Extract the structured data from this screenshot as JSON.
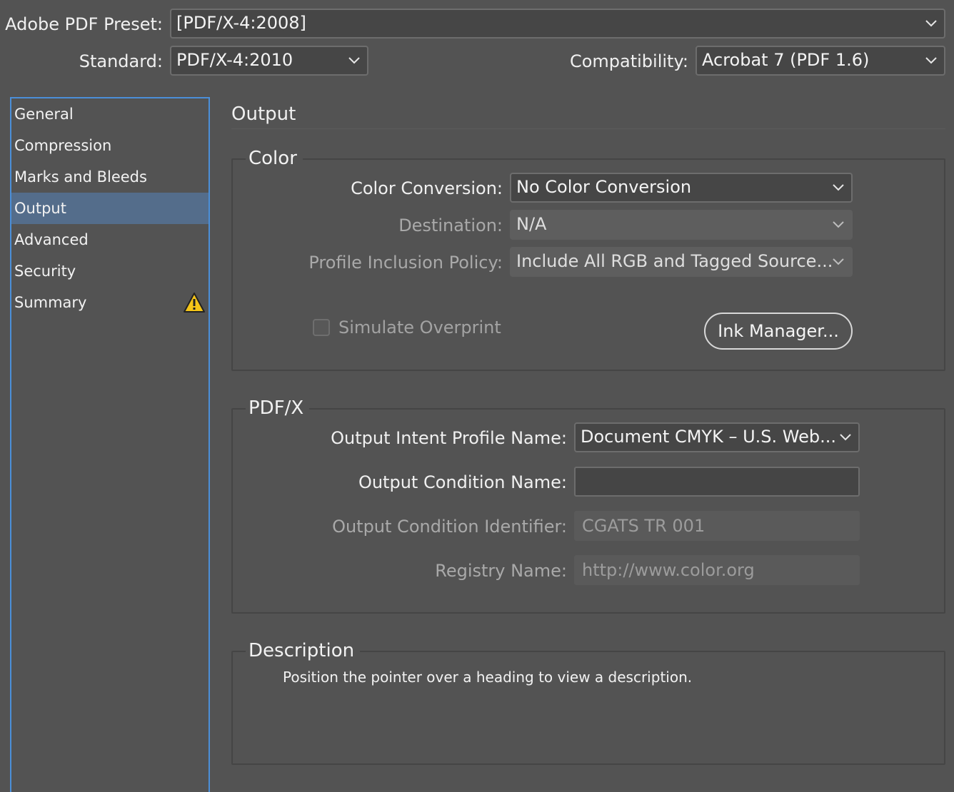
{
  "header": {
    "preset_label": "Adobe PDF Preset:",
    "preset_value": "[PDF/X-4:2008]",
    "standard_label": "Standard:",
    "standard_value": "PDF/X-4:2010",
    "compat_label": "Compatibility:",
    "compat_value": "Acrobat 7 (PDF 1.6)"
  },
  "sidebar": {
    "items": [
      {
        "label": "General"
      },
      {
        "label": "Compression"
      },
      {
        "label": "Marks and Bleeds"
      },
      {
        "label": "Output"
      },
      {
        "label": "Advanced"
      },
      {
        "label": "Security"
      },
      {
        "label": "Summary"
      }
    ],
    "active": "Output"
  },
  "main": {
    "title": "Output",
    "color": {
      "legend": "Color",
      "conversion_label": "Color Conversion:",
      "conversion_value": "No Color Conversion",
      "destination_label": "Destination:",
      "destination_value": "N/A",
      "policy_label": "Profile Inclusion Policy:",
      "policy_value": "Include All RGB and Tagged Source...",
      "simulate_overprint_label": "Simulate Overprint",
      "ink_manager_label": "Ink Manager..."
    },
    "pdfx": {
      "legend": "PDF/X",
      "intent_label": "Output Intent Profile Name:",
      "intent_value": "Document CMYK – U.S. Web...",
      "condition_name_label": "Output Condition Name:",
      "condition_name_value": "",
      "condition_id_label": "Output Condition Identifier:",
      "condition_id_value": "CGATS TR 001",
      "registry_label": "Registry Name:",
      "registry_value": "http://www.color.org"
    },
    "description": {
      "legend": "Description",
      "text": "Position the pointer over a heading to view a description."
    }
  },
  "colors": {
    "accent": "#4b8fd8",
    "active_item": "#546d8b",
    "warning": "#f5c518"
  },
  "icons": {
    "dropdown": "chevron-down-icon",
    "warning": "warning-triangle-icon"
  }
}
